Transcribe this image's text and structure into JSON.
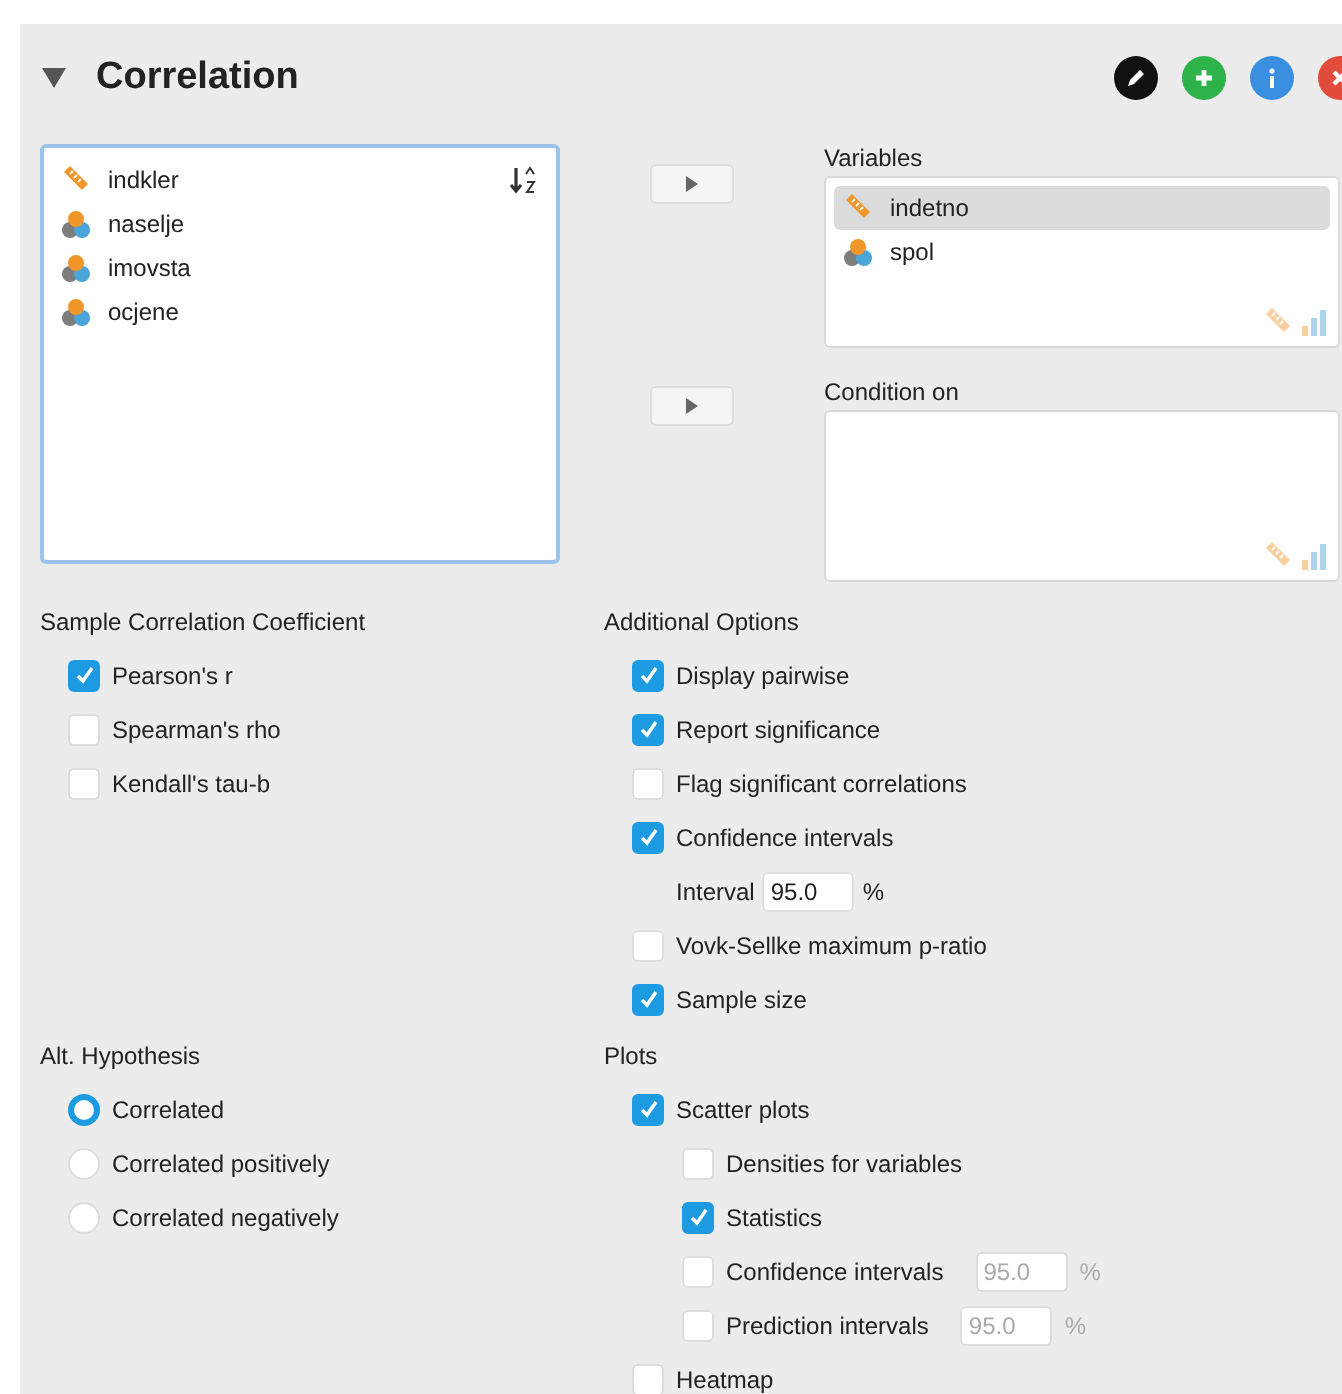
{
  "title": "Correlation",
  "expanded": true,
  "header_buttons": [
    {
      "kind": "edit"
    },
    {
      "kind": "add"
    },
    {
      "kind": "info"
    },
    {
      "kind": "close"
    }
  ],
  "source_list": {
    "items": [
      {
        "name": "indkler",
        "kind": "scale"
      },
      {
        "name": "naselje",
        "kind": "nominal"
      },
      {
        "name": "imovsta",
        "kind": "nominal"
      },
      {
        "name": "ocjene",
        "kind": "nominal"
      }
    ]
  },
  "targets": [
    {
      "label": "Variables",
      "items": [
        {
          "name": "indetno",
          "kind": "scale",
          "selected": true
        },
        {
          "name": "spol",
          "kind": "nominal",
          "selected": false
        }
      ]
    },
    {
      "label": "Condition on"
    }
  ],
  "sections": [
    {
      "title": "Sample Correlation Coefficient",
      "options": [
        {
          "kind": "checkbox",
          "label": "Pearson's r",
          "checked": true
        },
        {
          "kind": "checkbox",
          "label": "Spearman's rho",
          "checked": false
        },
        {
          "kind": "checkbox",
          "label": "Kendall's tau-b",
          "checked": false
        }
      ]
    },
    {
      "title": "Additional Options",
      "options": [
        {
          "kind": "checkbox",
          "label": "Display pairwise",
          "checked": true
        },
        {
          "kind": "checkbox",
          "label": "Report significance",
          "checked": true
        },
        {
          "kind": "checkbox",
          "label": "Flag significant correlations",
          "checked": false
        },
        {
          "kind": "checkbox",
          "label": "Confidence intervals",
          "checked": true
        },
        {
          "kind": "field",
          "label": "Interval",
          "value": "95.0",
          "unit": "%",
          "disabled": false
        },
        {
          "kind": "checkbox",
          "label": "Vovk-Sellke maximum p-ratio",
          "checked": false
        },
        {
          "kind": "checkbox",
          "label": "Sample size",
          "checked": true
        }
      ]
    },
    {
      "title": "Alt. Hypothesis",
      "options": [
        {
          "kind": "radio",
          "label": "Correlated",
          "selected": true
        },
        {
          "kind": "radio",
          "label": "Correlated positively",
          "selected": false
        },
        {
          "kind": "radio",
          "label": "Correlated negatively",
          "selected": false
        }
      ]
    },
    {
      "title": "Plots",
      "options": [
        {
          "kind": "checkbox",
          "label": "Scatter plots",
          "checked": true,
          "children": [
            {
              "kind": "checkbox",
              "label": "Densities for variables",
              "checked": false
            },
            {
              "kind": "checkbox",
              "label": "Statistics",
              "checked": true
            },
            {
              "kind": "checkbox",
              "label": "Confidence intervals",
              "checked": false,
              "field": {
                "value": "95.0",
                "unit": "%",
                "disabled": true
              }
            },
            {
              "kind": "checkbox",
              "label": "Prediction intervals",
              "checked": false,
              "field": {
                "value": "95.0",
                "unit": "%",
                "disabled": true
              }
            }
          ]
        },
        {
          "kind": "checkbox",
          "label": "Heatmap",
          "checked": false
        }
      ]
    }
  ]
}
